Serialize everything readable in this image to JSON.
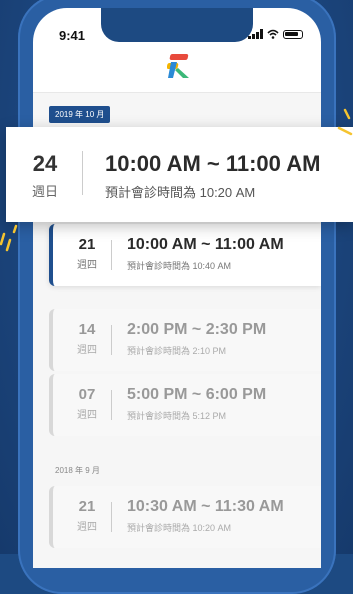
{
  "status_bar": {
    "time": "9:41"
  },
  "groups": [
    {
      "label": "2019 年 10 月"
    },
    {
      "label": "2018 年 9 月"
    }
  ],
  "highlight": {
    "day": "24",
    "weekday": "週日",
    "time": "10:00 AM ~ 11:00 AM",
    "estimate": "預計會診時間為 10:20 AM"
  },
  "appointments": [
    {
      "day": "21",
      "weekday": "週四",
      "time": "10:00 AM ~ 11:00 AM",
      "estimate": "預計會診時間為 10:40 AM"
    },
    {
      "day": "14",
      "weekday": "週四",
      "time": "2:00 PM ~ 2:30 PM",
      "estimate": "預計會診時間為 2:10 PM"
    },
    {
      "day": "07",
      "weekday": "週四",
      "time": "5:00 PM ~ 6:00 PM",
      "estimate": "預計會診時間為 5:12 PM"
    },
    {
      "day": "21",
      "weekday": "週四",
      "time": "10:30 AM ~ 11:30 AM",
      "estimate": "預計會診時間為 10:20 AM"
    }
  ],
  "colors": {
    "accent": "#1f4f8e",
    "background": "#1d4a82"
  }
}
